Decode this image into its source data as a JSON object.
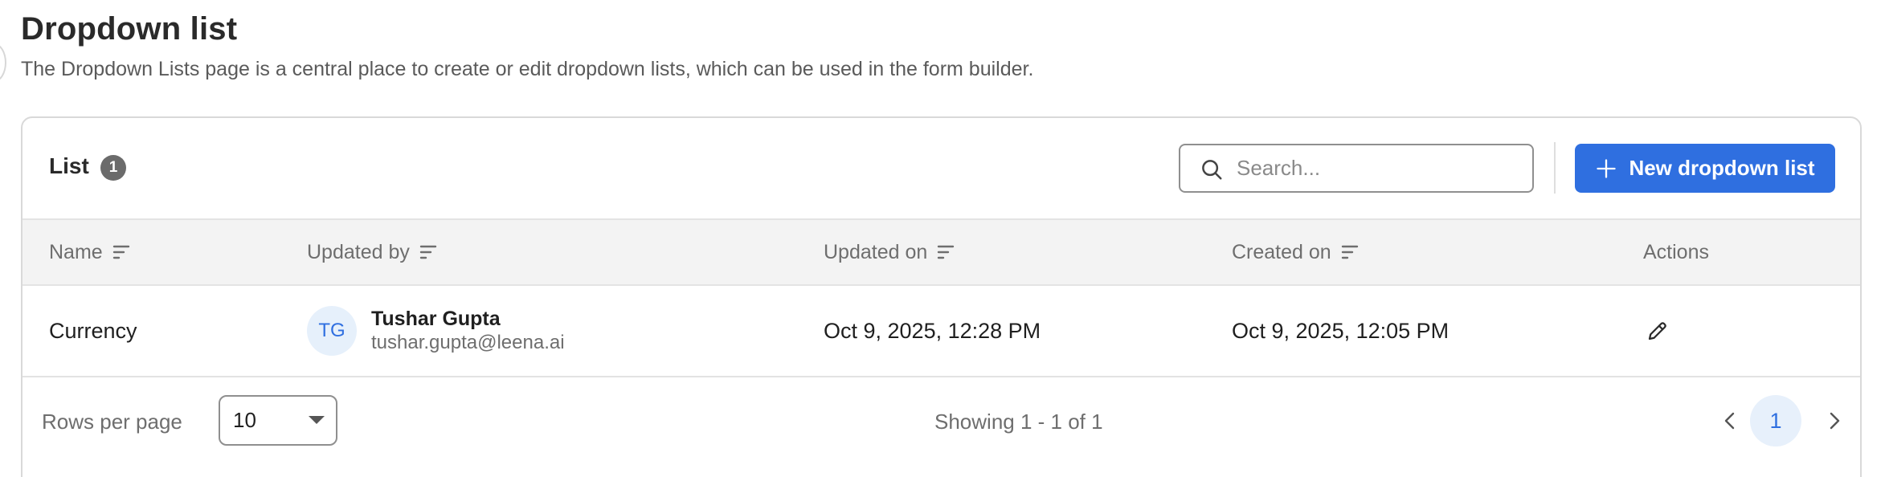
{
  "page": {
    "title": "Dropdown list",
    "description": "The Dropdown Lists page is a central place to create or edit dropdown lists, which can be used in the form builder."
  },
  "list": {
    "title": "List",
    "count": "1",
    "search_placeholder": "Search...",
    "new_button_label": "New dropdown list"
  },
  "table": {
    "columns": [
      {
        "label": "Name",
        "sortable": true
      },
      {
        "label": "Updated by",
        "sortable": true
      },
      {
        "label": "Updated on",
        "sortable": true
      },
      {
        "label": "Created on",
        "sortable": true
      },
      {
        "label": "Actions",
        "sortable": false
      }
    ],
    "rows": [
      {
        "name": "Currency",
        "updated_by": {
          "initials": "TG",
          "name": "Tushar Gupta",
          "email": "tushar.gupta@leena.ai"
        },
        "updated_on": "Oct 9, 2025, 12:28 PM",
        "created_on": "Oct 9, 2025, 12:05 PM",
        "action_icon": "edit-pencil-icon"
      }
    ]
  },
  "pagination": {
    "rows_per_page_label": "Rows per page",
    "rows_per_page_value": "10",
    "showing_text": "Showing 1 - 1 of 1",
    "current_page": "1"
  },
  "colors": {
    "accent": "#2f6fe0",
    "avatar_bg": "#e6f0fb",
    "header_bg": "#f3f3f3"
  }
}
